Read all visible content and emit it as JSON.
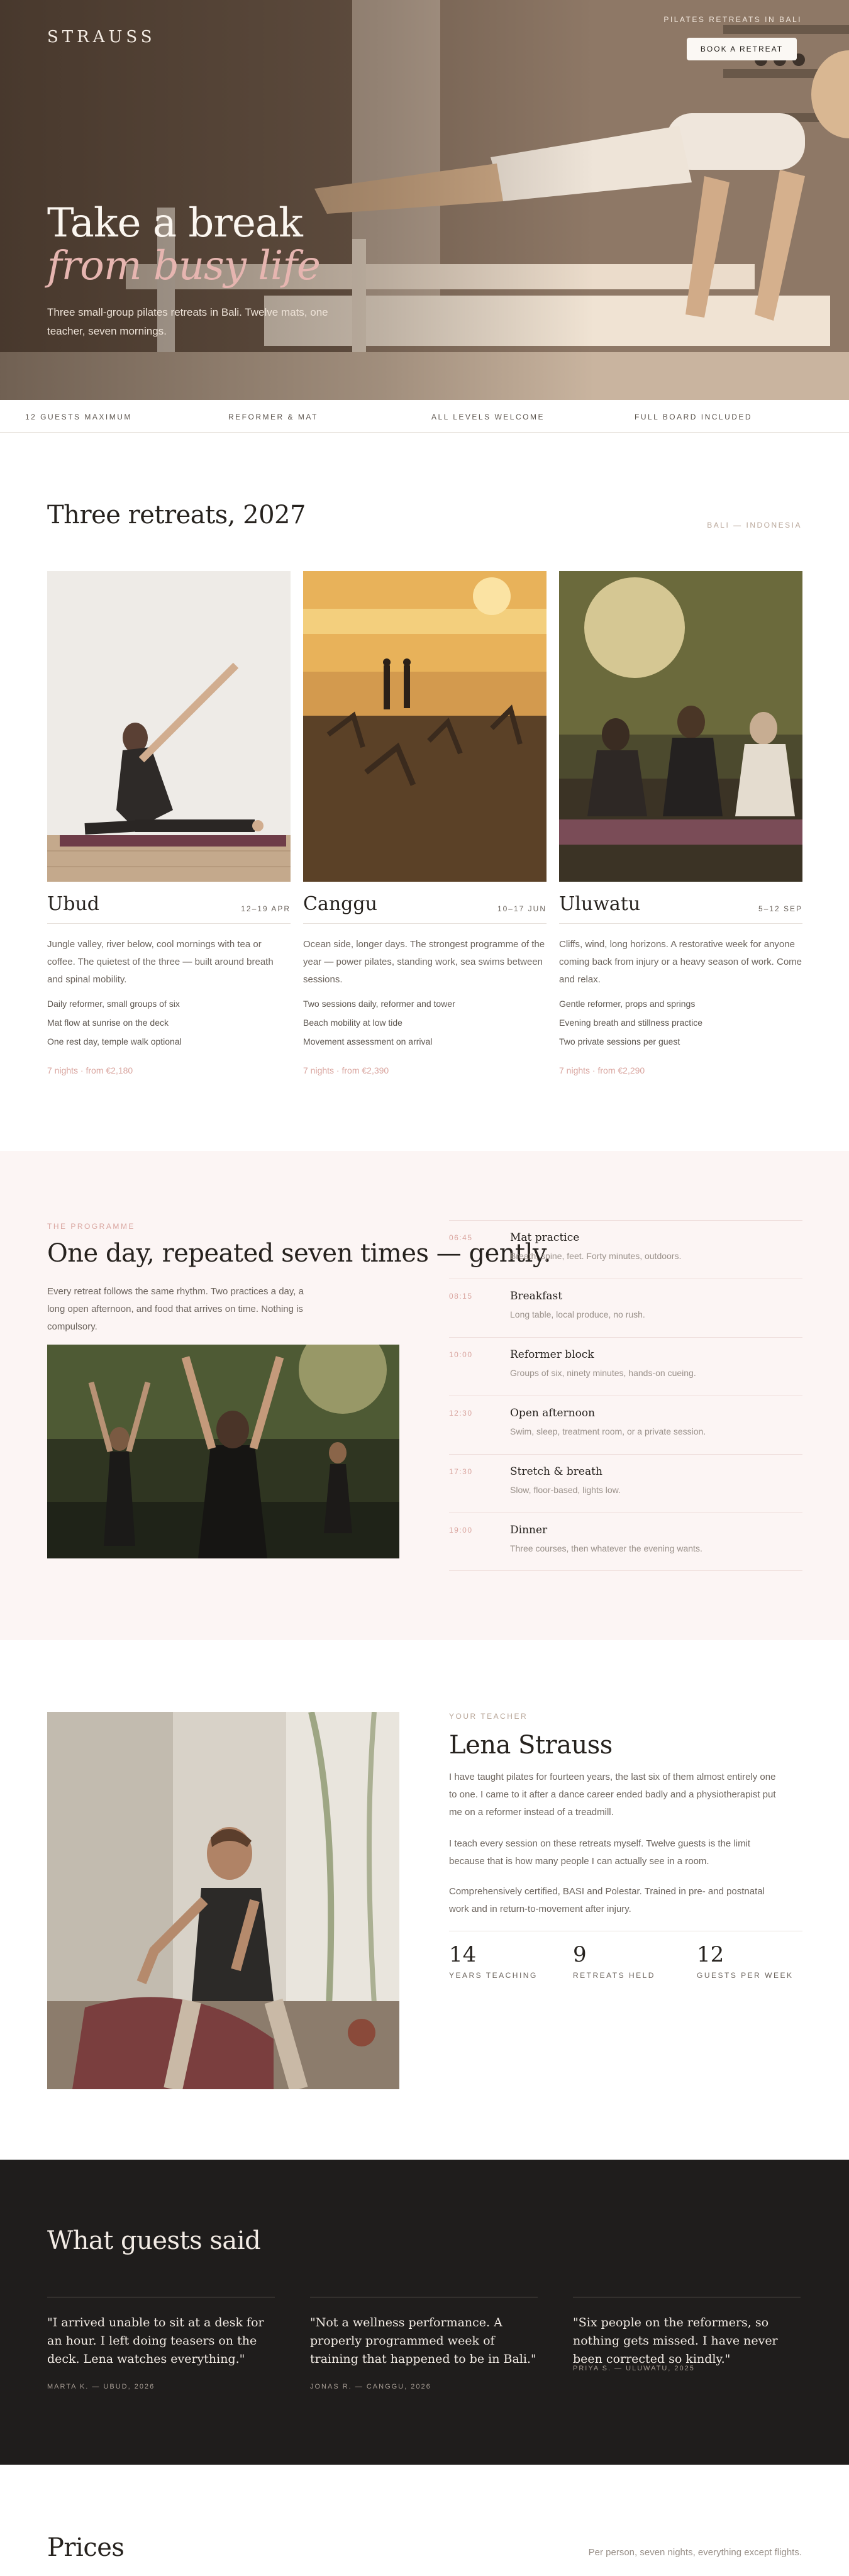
{
  "header": {
    "logo": "STRAUSS",
    "kicker": "PILATES RETREATS IN BALI",
    "book_button": "BOOK A RETREAT"
  },
  "hero": {
    "title_line1": "Take a break",
    "title_line2": "from busy life",
    "subtitle": "Three small-group pilates retreats in Bali. Twelve mats, one teacher, seven mornings."
  },
  "strip": [
    "12 GUESTS MAXIMUM",
    "REFORMER & MAT",
    "ALL LEVELS WELCOME",
    "FULL BOARD INCLUDED"
  ],
  "retreats": {
    "title": "Three retreats, 2027",
    "tag": "BALI — INDONESIA",
    "items": [
      {
        "name": "Ubud",
        "dates": "12–19 APR",
        "description": "Jungle valley, river below, cool mornings with tea or coffee. The quietest of the three — built around breath and spinal mobility.",
        "features": [
          "Daily reformer, small groups of six",
          "Mat flow at sunrise on the deck",
          "One rest day, temple walk optional"
        ],
        "price": "7 nights · from €2,180"
      },
      {
        "name": "Canggu",
        "dates": "10–17 JUN",
        "description": "Ocean side, longer days. The strongest programme of the year — power pilates, standing work, sea swims between sessions.",
        "features": [
          "Two sessions daily, reformer and tower",
          "Beach mobility at low tide",
          "Movement assessment on arrival"
        ],
        "price": "7 nights · from €2,390"
      },
      {
        "name": "Uluwatu",
        "dates": "5–12 SEP",
        "description": "Cliffs, wind, long horizons. A restorative week for anyone coming back from injury or a heavy season of work. Come and relax.",
        "features": [
          "Gentle reformer, props and springs",
          "Evening breath and stillness practice",
          "Two private sessions per guest"
        ],
        "price": "7 nights · from €2,290"
      }
    ]
  },
  "programme": {
    "label": "THE PROGRAMME",
    "title": "One day, repeated seven times — gently.",
    "description": "Every retreat follows the same rhythm. Two practices a day, a long open afternoon, and food that arrives on time. Nothing is compulsory.",
    "schedule": [
      {
        "time": "06:45",
        "title": "Mat practice",
        "note": "Breath, spine, feet. Forty minutes, outdoors."
      },
      {
        "time": "08:15",
        "title": "Breakfast",
        "note": "Long table, local produce, no rush."
      },
      {
        "time": "10:00",
        "title": "Reformer block",
        "note": "Groups of six, ninety minutes, hands-on cueing."
      },
      {
        "time": "12:30",
        "title": "Open afternoon",
        "note": "Swim, sleep, treatment room, or a private session."
      },
      {
        "time": "17:30",
        "title": "Stretch & breath",
        "note": "Slow, floor-based, lights low."
      },
      {
        "time": "19:00",
        "title": "Dinner",
        "note": "Three courses, then whatever the evening wants."
      }
    ]
  },
  "teacher": {
    "label": "YOUR TEACHER",
    "name": "Lena Strauss",
    "paragraphs": [
      "I have taught pilates for fourteen years, the last six of them almost entirely one to one. I came to it after a dance career ended badly and a physiotherapist put me on a reformer instead of a treadmill.",
      "I teach every session on these retreats myself. Twelve guests is the limit because that is how many people I can actually see in a room.",
      "Comprehensively certified, BASI and Polestar. Trained in pre- and postnatal work and in return-to-movement after injury."
    ],
    "stats": [
      {
        "value": "14",
        "label": "YEARS TEACHING"
      },
      {
        "value": "9",
        "label": "RETREATS HELD"
      },
      {
        "value": "12",
        "label": "GUESTS PER WEEK"
      }
    ]
  },
  "testimonials": {
    "title": "What guests said",
    "items": [
      {
        "quote": "\"I arrived unable to sit at a desk for an hour. I left doing teasers on the deck. Lena watches everything.\"",
        "author": "MARTA K. — UBUD, 2026"
      },
      {
        "quote": "\"Not a wellness performance. A properly programmed week of training that happened to be in Bali.\"",
        "author": "JONAS R. — CANGGU, 2026"
      },
      {
        "quote": "\"Six people on the reformers, so nothing gets missed. I have never been corrected so kindly.\"",
        "author": "PRIYA S. — ULUWATU, 2025"
      }
    ]
  },
  "prices": {
    "title": "Prices",
    "note": "Per person, seven nights, everything except flights."
  }
}
